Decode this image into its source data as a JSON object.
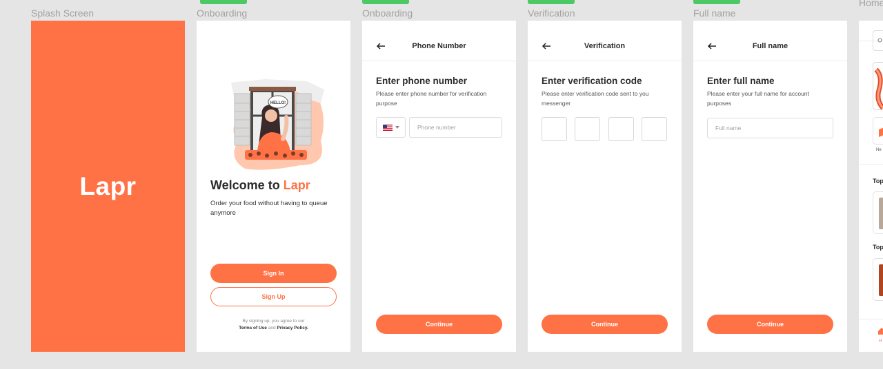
{
  "frames": {
    "splash": {
      "label": "Splash Screen",
      "logo": "Lapr"
    },
    "onboarding": {
      "label": "Onboarding",
      "speech_bubble": "HELLO!",
      "welcome_prefix": "Welcome to ",
      "welcome_accent": "Lapr",
      "description": "Order your food without having to queue anymore",
      "sign_in": "Sign In",
      "sign_up": "Sign Up",
      "terms_prefix": "By signing up, you agree to our",
      "terms_link": "Terms of Use",
      "terms_and": " and ",
      "privacy_link": "Privacy Policy."
    },
    "phone": {
      "label": "Onboarding",
      "header_title": "Phone Number",
      "title": "Enter phone number",
      "description": "Please enter phone number for verification purpose",
      "phone_placeholder": "Phone number",
      "continue": "Continue"
    },
    "verification": {
      "label": "Verification",
      "header_title": "Verification",
      "title": "Enter verification code",
      "description": "Please enter verification code sent to you messenger",
      "continue": "Continue"
    },
    "full_name": {
      "label": "Full name",
      "header_title": "Full name",
      "title": "Enter full name",
      "description": "Please enter your full name for account purposes",
      "name_placeholder": "Full name",
      "continue": "Continue"
    },
    "home": {
      "label": "Home",
      "section_1": "Top",
      "section_2": "Top",
      "category": "Ne",
      "tab_label": "H"
    }
  },
  "colors": {
    "brand": "#ff7246",
    "badge": "#4cc964",
    "canvas": "#e5e5e5"
  },
  "icons": [
    "back-arrow-icon",
    "us-flag-icon",
    "chevron-down-icon",
    "home-icon"
  ]
}
